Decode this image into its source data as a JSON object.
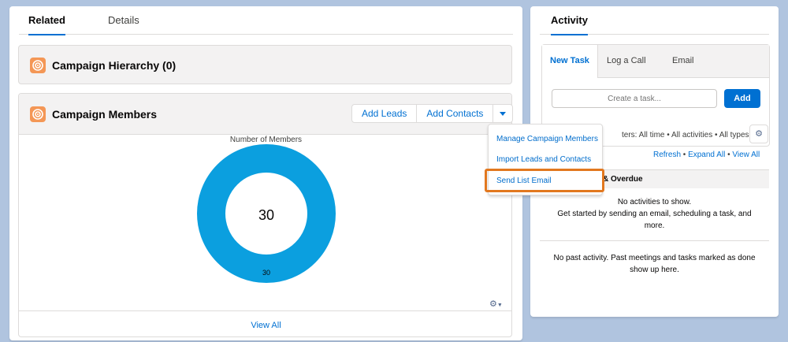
{
  "tabs": {
    "related": "Related",
    "details": "Details"
  },
  "campaign_hierarchy": {
    "title": "Campaign Hierarchy (0)",
    "icon": "campaign-icon"
  },
  "campaign_members": {
    "title": "Campaign Members",
    "icon": "campaign-icon",
    "add_leads": "Add Leads",
    "add_contacts": "Add Contacts",
    "chart_title": "Number of Members",
    "view_all": "View All"
  },
  "dropdown": {
    "items": [
      "Manage Campaign Members",
      "Import Leads and Contacts",
      "Send List Email"
    ]
  },
  "chart_data": {
    "type": "pie",
    "title": "Number of Members",
    "categories": [
      ""
    ],
    "values": [
      30
    ],
    "center_label": "30",
    "slice_label": "30",
    "colors": [
      "#0b9fdf"
    ]
  },
  "activity": {
    "tab_title": "Activity",
    "subtabs": {
      "new_task": "New Task",
      "log_call": "Log a Call",
      "email": "Email"
    },
    "task_placeholder": "Create a task...",
    "add": "Add",
    "filters": "ters: All time • All activities • All types",
    "refresh": "Refresh",
    "expand_all": "Expand All",
    "view_all": "View All",
    "section": "& Overdue",
    "empty_line1": "No activities to show.",
    "empty_line2": "Get started by sending an email, scheduling a task, and",
    "empty_line3": "more.",
    "past_line1": "No past activity. Past meetings and tasks marked as done",
    "past_line2": "show up here."
  },
  "colors": {
    "accent": "#0070d2",
    "highlight": "#e2781f",
    "campaign_icon": "#f49756",
    "chart": "#0b9fdf",
    "background": "#b0c4df"
  }
}
